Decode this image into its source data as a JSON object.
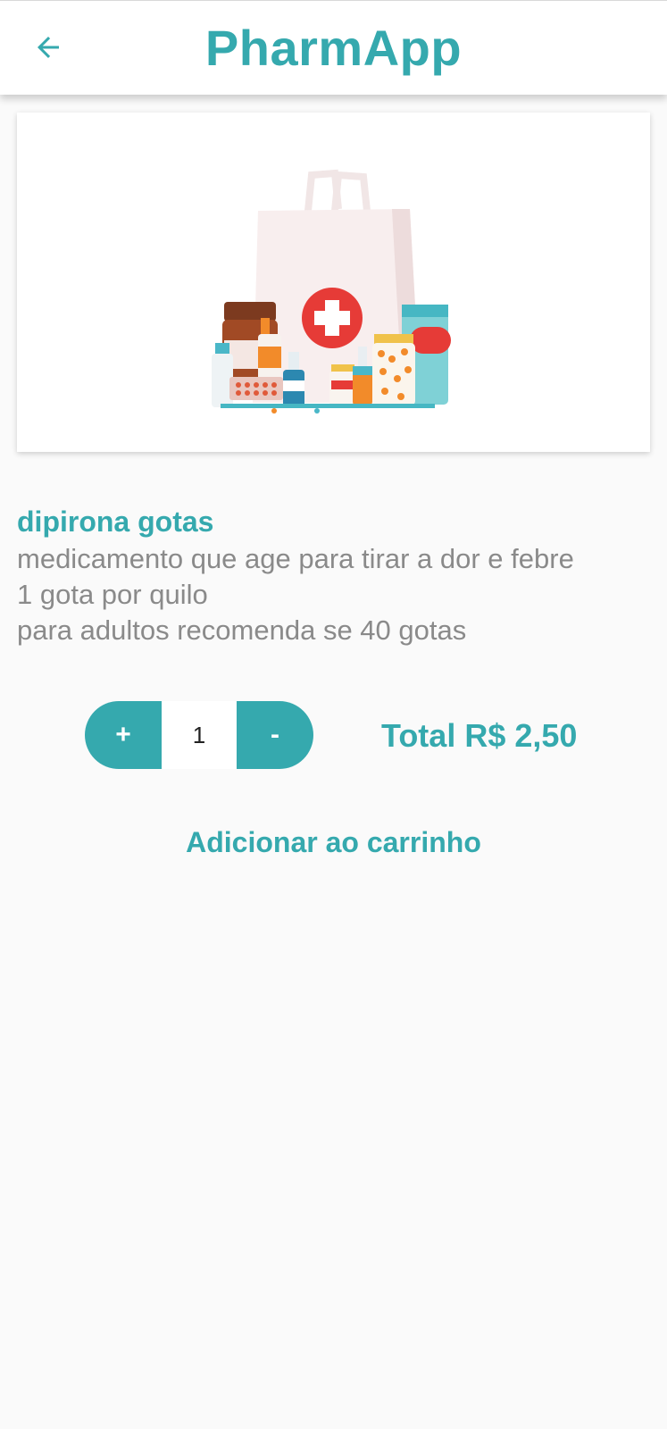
{
  "appbar": {
    "title": "PharmApp",
    "back_icon": "arrow-left-icon"
  },
  "product": {
    "name": "dipirona gotas",
    "description_lines": [
      "medicamento que age para tirar a dor e febre",
      "1 gota por quilo",
      "para adultos recomenda se 40 gotas"
    ]
  },
  "quantity": {
    "plus_label": "+",
    "value": "1",
    "minus_label": "-"
  },
  "total": "Total R$ 2,50",
  "add_to_cart": "Adicionar ao carrinho",
  "colors": {
    "accent": "#35a9ae",
    "text_secondary": "#8a8a8a",
    "background": "#fafafa"
  }
}
